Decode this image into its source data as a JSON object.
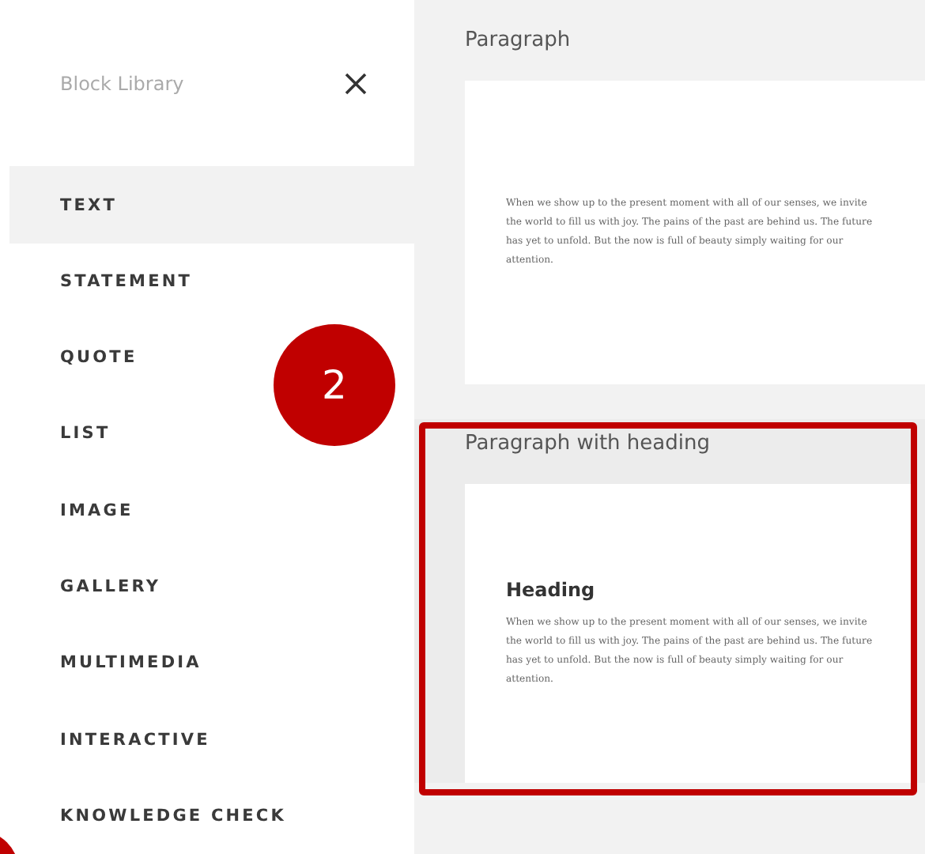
{
  "sidebar": {
    "title": "Block Library",
    "items": [
      {
        "label": "TEXT",
        "selected": true
      },
      {
        "label": "STATEMENT",
        "selected": false
      },
      {
        "label": "QUOTE",
        "selected": false
      },
      {
        "label": "LIST",
        "selected": false
      },
      {
        "label": "IMAGE",
        "selected": false
      },
      {
        "label": "GALLERY",
        "selected": false
      },
      {
        "label": "MULTIMEDIA",
        "selected": false
      },
      {
        "label": "INTERACTIVE",
        "selected": false
      },
      {
        "label": "KNOWLEDGE CHECK",
        "selected": false
      }
    ]
  },
  "blocks": [
    {
      "title": "Paragraph",
      "highlighted": false,
      "body": "When we show up to the present moment with all of our senses, we invite the world to fill us with joy. The pains of the past are behind us. The future has yet to unfold. But the now is full of beauty simply waiting for our attention."
    },
    {
      "title": "Paragraph with heading",
      "highlighted": true,
      "heading": "Heading",
      "body": "When we show up to the present moment with all of our senses, we invite the world to fill us with joy. The pains of the past are behind us. The future has yet to unfold. But the now is full of beauty simply waiting for our attention."
    }
  ],
  "callout": {
    "number": "2"
  }
}
